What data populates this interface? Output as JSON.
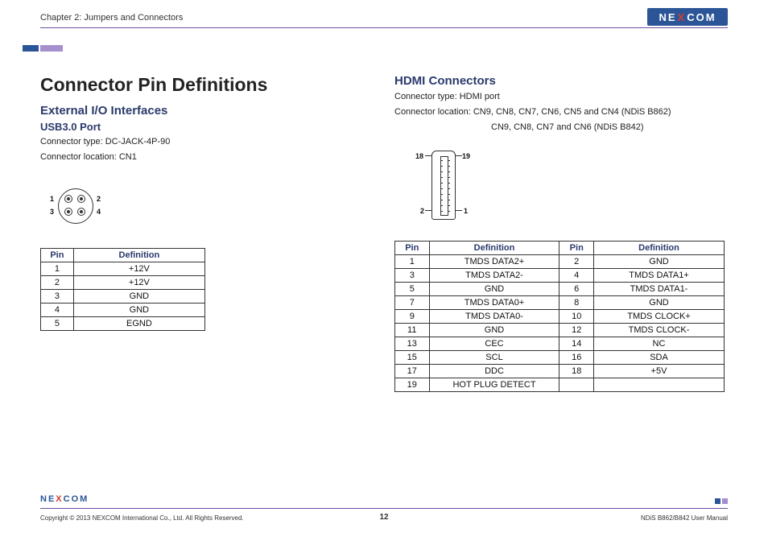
{
  "header": {
    "chapter": "Chapter 2: Jumpers and Connectors",
    "logo_a": "NE",
    "logo_x": "X",
    "logo_b": "COM"
  },
  "left": {
    "main_title": "Connector Pin Definitions",
    "section": "External I/O Interfaces",
    "subsection": "USB3.0 Port",
    "conn_type": "Connector type: DC-JACK-4P-90",
    "conn_loc": "Connector location: CN1",
    "labels": {
      "p1": "1",
      "p2": "2",
      "p3": "3",
      "p4": "4"
    },
    "table": {
      "h_pin": "Pin",
      "h_def": "Definition",
      "rows": [
        {
          "pin": "1",
          "def": "+12V"
        },
        {
          "pin": "2",
          "def": "+12V"
        },
        {
          "pin": "3",
          "def": "GND"
        },
        {
          "pin": "4",
          "def": "GND"
        },
        {
          "pin": "5",
          "def": "EGND"
        }
      ]
    }
  },
  "right": {
    "section": "HDMI Connectors",
    "conn_type": "Connector type: HDMI port",
    "conn_loc1": "Connector location: CN9, CN8, CN7, CN6, CN5 and CN4 (NDiS B862)",
    "conn_loc2": "CN9, CN8, CN7 and CN6 (NDiS B842)",
    "labels": {
      "p18": "18",
      "p19": "19",
      "p2": "2",
      "p1": "1"
    },
    "table": {
      "h_pin": "Pin",
      "h_def": "Definition",
      "rows": [
        {
          "p1": "1",
          "d1": "TMDS DATA2+",
          "p2": "2",
          "d2": "GND"
        },
        {
          "p1": "3",
          "d1": "TMDS DATA2-",
          "p2": "4",
          "d2": "TMDS DATA1+"
        },
        {
          "p1": "5",
          "d1": "GND",
          "p2": "6",
          "d2": "TMDS DATA1-"
        },
        {
          "p1": "7",
          "d1": "TMDS DATA0+",
          "p2": "8",
          "d2": "GND"
        },
        {
          "p1": "9",
          "d1": "TMDS DATA0-",
          "p2": "10",
          "d2": "TMDS CLOCK+"
        },
        {
          "p1": "11",
          "d1": "GND",
          "p2": "12",
          "d2": "TMDS CLOCK-"
        },
        {
          "p1": "13",
          "d1": "CEC",
          "p2": "14",
          "d2": "NC"
        },
        {
          "p1": "15",
          "d1": "SCL",
          "p2": "16",
          "d2": "SDA"
        },
        {
          "p1": "17",
          "d1": "DDC",
          "p2": "18",
          "d2": "+5V"
        },
        {
          "p1": "19",
          "d1": "HOT PLUG DETECT",
          "p2": "",
          "d2": ""
        }
      ]
    }
  },
  "footer": {
    "logo_a": "NE",
    "logo_x": "X",
    "logo_b": "COM",
    "copyright": "Copyright © 2013 NEXCOM International Co., Ltd. All Rights Reserved.",
    "page": "12",
    "manual": "NDiS B862/B842 User Manual"
  }
}
